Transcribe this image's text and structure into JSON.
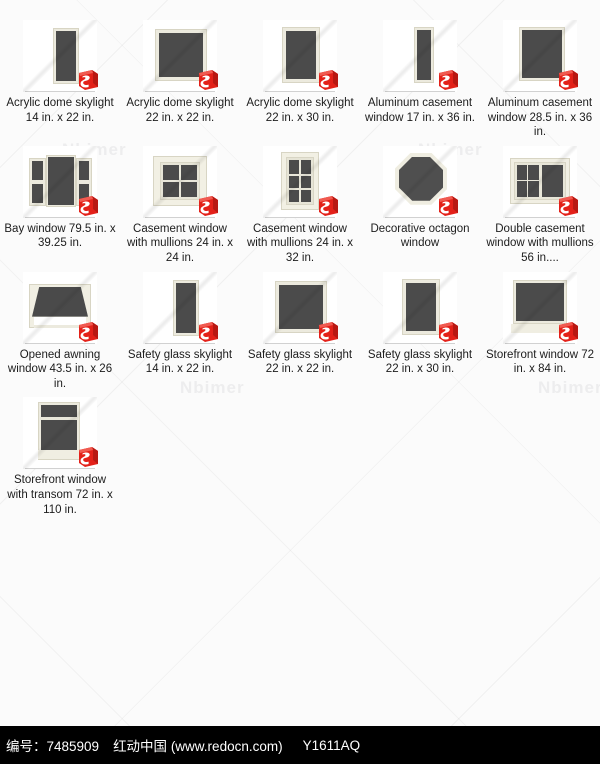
{
  "page": {
    "background_color": "#fbfbfb",
    "watermark_text": "Nbimer",
    "badge_icon": "sketchup-logo-icon",
    "badge_color": "#e32119"
  },
  "items": [
    {
      "caption": "Acrylic dome skylight 14 in. x 22 in.",
      "type": "skylight-narrow"
    },
    {
      "caption": "Acrylic dome skylight 22 in. x 22 in.",
      "type": "skylight-square"
    },
    {
      "caption": "Acrylic dome skylight 22 in. x 30 in.",
      "type": "skylight-tall"
    },
    {
      "caption": "Aluminum casement window 17 in. x 36 in.",
      "type": "casement-narrow"
    },
    {
      "caption": "Aluminum casement window 28.5 in. x 36 in.",
      "type": "casement-wide"
    },
    {
      "caption": "Bay window 79.5 in. x 39.25 in.",
      "type": "bay"
    },
    {
      "caption": "Casement window with mullions 24 in. x 24 in.",
      "type": "mullion-square"
    },
    {
      "caption": "Casement window with mullions 24 in. x 32 in.",
      "type": "mullion-tall"
    },
    {
      "caption": "Decorative octagon window",
      "type": "octagon"
    },
    {
      "caption": "Double casement window with mullions 56 in....",
      "type": "double-casement"
    },
    {
      "caption": "Opened awning window 43.5 in. x 26 in.",
      "type": "awning"
    },
    {
      "caption": "Safety glass skylight 14 in. x 22 in.",
      "type": "skylight-narrow"
    },
    {
      "caption": "Safety glass skylight 22 in. x 22 in.",
      "type": "skylight-square"
    },
    {
      "caption": "Safety glass skylight 22 in. x 30 in.",
      "type": "skylight-tall"
    },
    {
      "caption": "Storefront window 72 in. x 84 in.",
      "type": "storefront"
    },
    {
      "caption": "Storefront window with transom 72 in. x 110 in.",
      "type": "storefront-transom"
    }
  ],
  "footer": {
    "id_label": "编号：7485909",
    "site_label": "红动中国 (www.redocn.com)",
    "code_label": "Y1611AQ",
    "background_color": "#000000",
    "text_color": "#ffffff"
  }
}
